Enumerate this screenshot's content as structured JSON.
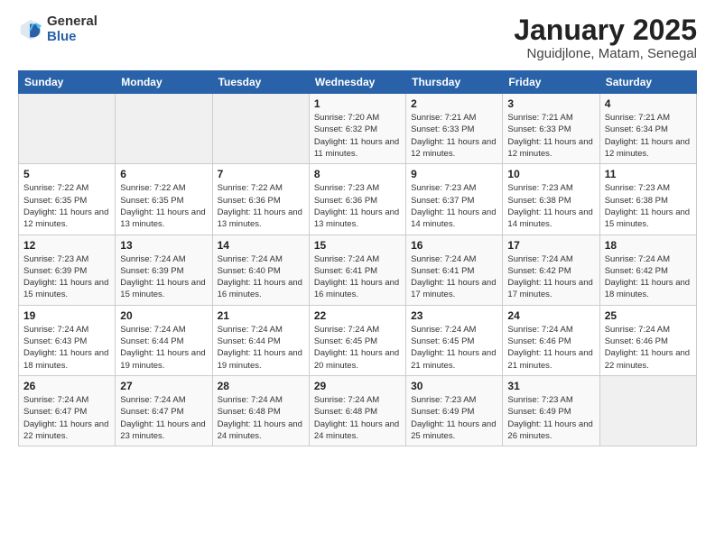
{
  "logo": {
    "general": "General",
    "blue": "Blue"
  },
  "header": {
    "month": "January 2025",
    "location": "Nguidjlone, Matam, Senegal"
  },
  "weekdays": [
    "Sunday",
    "Monday",
    "Tuesday",
    "Wednesday",
    "Thursday",
    "Friday",
    "Saturday"
  ],
  "weeks": [
    [
      {
        "day": "",
        "info": ""
      },
      {
        "day": "",
        "info": ""
      },
      {
        "day": "",
        "info": ""
      },
      {
        "day": "1",
        "info": "Sunrise: 7:20 AM\nSunset: 6:32 PM\nDaylight: 11 hours\nand 11 minutes."
      },
      {
        "day": "2",
        "info": "Sunrise: 7:21 AM\nSunset: 6:33 PM\nDaylight: 11 hours\nand 12 minutes."
      },
      {
        "day": "3",
        "info": "Sunrise: 7:21 AM\nSunset: 6:33 PM\nDaylight: 11 hours\nand 12 minutes."
      },
      {
        "day": "4",
        "info": "Sunrise: 7:21 AM\nSunset: 6:34 PM\nDaylight: 11 hours\nand 12 minutes."
      }
    ],
    [
      {
        "day": "5",
        "info": "Sunrise: 7:22 AM\nSunset: 6:35 PM\nDaylight: 11 hours\nand 12 minutes."
      },
      {
        "day": "6",
        "info": "Sunrise: 7:22 AM\nSunset: 6:35 PM\nDaylight: 11 hours\nand 13 minutes."
      },
      {
        "day": "7",
        "info": "Sunrise: 7:22 AM\nSunset: 6:36 PM\nDaylight: 11 hours\nand 13 minutes."
      },
      {
        "day": "8",
        "info": "Sunrise: 7:23 AM\nSunset: 6:36 PM\nDaylight: 11 hours\nand 13 minutes."
      },
      {
        "day": "9",
        "info": "Sunrise: 7:23 AM\nSunset: 6:37 PM\nDaylight: 11 hours\nand 14 minutes."
      },
      {
        "day": "10",
        "info": "Sunrise: 7:23 AM\nSunset: 6:38 PM\nDaylight: 11 hours\nand 14 minutes."
      },
      {
        "day": "11",
        "info": "Sunrise: 7:23 AM\nSunset: 6:38 PM\nDaylight: 11 hours\nand 15 minutes."
      }
    ],
    [
      {
        "day": "12",
        "info": "Sunrise: 7:23 AM\nSunset: 6:39 PM\nDaylight: 11 hours\nand 15 minutes."
      },
      {
        "day": "13",
        "info": "Sunrise: 7:24 AM\nSunset: 6:39 PM\nDaylight: 11 hours\nand 15 minutes."
      },
      {
        "day": "14",
        "info": "Sunrise: 7:24 AM\nSunset: 6:40 PM\nDaylight: 11 hours\nand 16 minutes."
      },
      {
        "day": "15",
        "info": "Sunrise: 7:24 AM\nSunset: 6:41 PM\nDaylight: 11 hours\nand 16 minutes."
      },
      {
        "day": "16",
        "info": "Sunrise: 7:24 AM\nSunset: 6:41 PM\nDaylight: 11 hours\nand 17 minutes."
      },
      {
        "day": "17",
        "info": "Sunrise: 7:24 AM\nSunset: 6:42 PM\nDaylight: 11 hours\nand 17 minutes."
      },
      {
        "day": "18",
        "info": "Sunrise: 7:24 AM\nSunset: 6:42 PM\nDaylight: 11 hours\nand 18 minutes."
      }
    ],
    [
      {
        "day": "19",
        "info": "Sunrise: 7:24 AM\nSunset: 6:43 PM\nDaylight: 11 hours\nand 18 minutes."
      },
      {
        "day": "20",
        "info": "Sunrise: 7:24 AM\nSunset: 6:44 PM\nDaylight: 11 hours\nand 19 minutes."
      },
      {
        "day": "21",
        "info": "Sunrise: 7:24 AM\nSunset: 6:44 PM\nDaylight: 11 hours\nand 19 minutes."
      },
      {
        "day": "22",
        "info": "Sunrise: 7:24 AM\nSunset: 6:45 PM\nDaylight: 11 hours\nand 20 minutes."
      },
      {
        "day": "23",
        "info": "Sunrise: 7:24 AM\nSunset: 6:45 PM\nDaylight: 11 hours\nand 21 minutes."
      },
      {
        "day": "24",
        "info": "Sunrise: 7:24 AM\nSunset: 6:46 PM\nDaylight: 11 hours\nand 21 minutes."
      },
      {
        "day": "25",
        "info": "Sunrise: 7:24 AM\nSunset: 6:46 PM\nDaylight: 11 hours\nand 22 minutes."
      }
    ],
    [
      {
        "day": "26",
        "info": "Sunrise: 7:24 AM\nSunset: 6:47 PM\nDaylight: 11 hours\nand 22 minutes."
      },
      {
        "day": "27",
        "info": "Sunrise: 7:24 AM\nSunset: 6:47 PM\nDaylight: 11 hours\nand 23 minutes."
      },
      {
        "day": "28",
        "info": "Sunrise: 7:24 AM\nSunset: 6:48 PM\nDaylight: 11 hours\nand 24 minutes."
      },
      {
        "day": "29",
        "info": "Sunrise: 7:24 AM\nSunset: 6:48 PM\nDaylight: 11 hours\nand 24 minutes."
      },
      {
        "day": "30",
        "info": "Sunrise: 7:23 AM\nSunset: 6:49 PM\nDaylight: 11 hours\nand 25 minutes."
      },
      {
        "day": "31",
        "info": "Sunrise: 7:23 AM\nSunset: 6:49 PM\nDaylight: 11 hours\nand 26 minutes."
      },
      {
        "day": "",
        "info": ""
      }
    ]
  ]
}
